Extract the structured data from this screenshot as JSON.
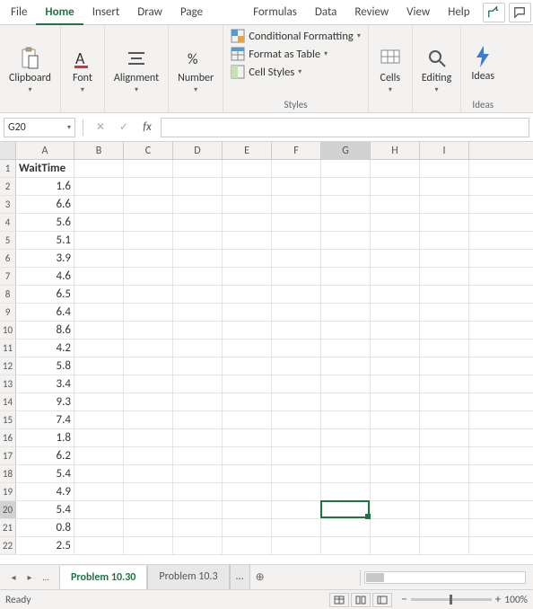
{
  "tabs": [
    "File",
    "Home",
    "Insert",
    "Draw",
    "Page Layout",
    "Formulas",
    "Data",
    "Review",
    "View",
    "Help"
  ],
  "active_tab": "Home",
  "ribbon": {
    "clipboard": "Clipboard",
    "font": "Font",
    "alignment": "Alignment",
    "number": "Number",
    "styles_label": "Styles",
    "cond_fmt": "Conditional Formatting",
    "fmt_table": "Format as Table",
    "cell_styles": "Cell Styles",
    "cells": "Cells",
    "editing": "Editing",
    "ideas": "Ideas"
  },
  "namebox": "G20",
  "columns": [
    "A",
    "B",
    "C",
    "D",
    "E",
    "F",
    "G",
    "H",
    "I"
  ],
  "selected_col": "G",
  "selected_row": 20,
  "row_header_label": "WaitTime",
  "data_values": [
    1.6,
    6.6,
    5.6,
    5.1,
    3.9,
    4.6,
    6.5,
    6.4,
    8.6,
    4.2,
    5.8,
    3.4,
    9.3,
    7.4,
    1.8,
    6.2,
    5.4,
    4.9,
    5.4,
    0.8,
    2.5
  ],
  "sheet_tabs": {
    "active": "Problem 10.30",
    "second": "Problem 10.3",
    "ellipsis": "...",
    "more": "..."
  },
  "status": {
    "ready": "Ready",
    "zoom": "100%"
  }
}
